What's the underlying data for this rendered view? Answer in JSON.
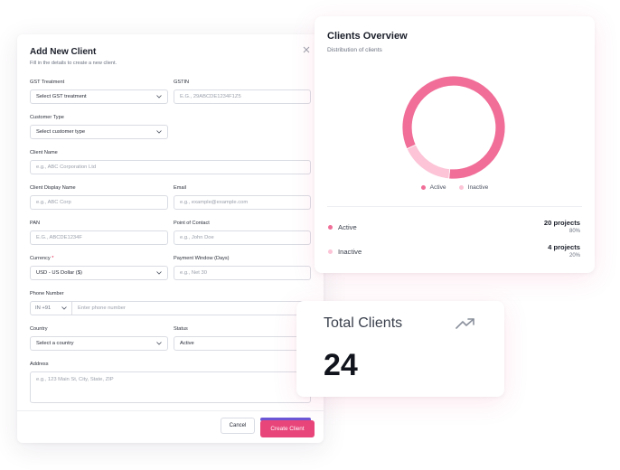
{
  "form": {
    "title": "Add New Client",
    "subtitle": "Fill in the details to create a new client.",
    "fields": {
      "gst_treatment": {
        "label": "GST Treatment",
        "value": "Select GST treatment"
      },
      "gstin": {
        "label": "GSTIN",
        "placeholder": "E.G., 29ABCDE1234F1Z5"
      },
      "customer_type": {
        "label": "Customer Type",
        "value": "Select customer type"
      },
      "client_name": {
        "label": "Client Name",
        "placeholder": "e.g., ABC Corporation Ltd"
      },
      "client_display_name": {
        "label": "Client Display Name",
        "placeholder": "e.g., ABC Corp"
      },
      "email": {
        "label": "Email",
        "placeholder": "e.g., example@example.com"
      },
      "pan": {
        "label": "PAN",
        "placeholder": "E.G., ABCDE1234F"
      },
      "point_of_contact": {
        "label": "Point of Contact",
        "placeholder": "e.g., John Doe"
      },
      "currency": {
        "label": "Currency",
        "required_mark": "*",
        "value": "USD - US Dollar ($)"
      },
      "payment_window": {
        "label": "Payment Window (Days)",
        "placeholder": "e.g., Net 30"
      },
      "phone_number": {
        "label": "Phone Number",
        "country_code": "IN +91",
        "placeholder": "Enter phone number"
      },
      "country": {
        "label": "Country",
        "value": "Select a country"
      },
      "status": {
        "label": "Status",
        "value": "Active"
      },
      "address": {
        "label": "Address",
        "placeholder": "e.g., 123 Main St, City, State, ZIP"
      }
    },
    "buttons": {
      "cancel": "Cancel",
      "create": "Create Client"
    }
  },
  "overview": {
    "title": "Clients Overview",
    "subtitle": "Distribution of clients",
    "rows": [
      {
        "label": "Active",
        "count": "20 projects",
        "percent": "80%"
      },
      {
        "label": "Inactive",
        "count": "4 projects",
        "percent": "20%"
      }
    ]
  },
  "chart_data": {
    "type": "pie",
    "categories": [
      "Active",
      "Inactive"
    ],
    "values": [
      20,
      4
    ],
    "legend": "bottom",
    "colors": [
      "#f06e98",
      "#fcc4d6"
    ]
  },
  "total": {
    "label": "Total Clients",
    "value": "24",
    "icon": "trending-up-icon"
  },
  "colors": {
    "accent": "#e8457a",
    "active": "#f06e98",
    "inactive": "#fcc4d6"
  }
}
